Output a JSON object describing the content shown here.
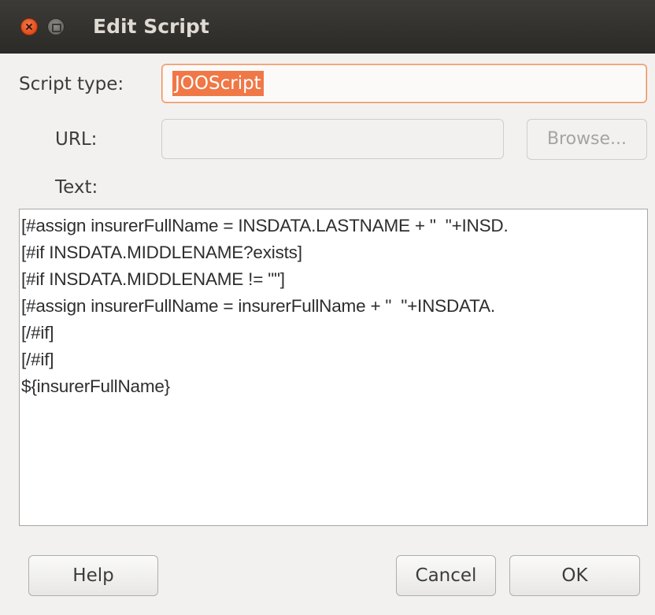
{
  "window": {
    "title": "Edit Script"
  },
  "form": {
    "script_type_label": "Script type:",
    "script_type_value": "JOOScript",
    "url_label": "URL:",
    "url_value": "",
    "browse_label": "Browse...",
    "text_label": "Text:"
  },
  "script_lines": [
    "[#assign insurerFullName = INSDATA.LASTNAME + \"  \"+INSD.",
    "[#if INSDATA.MIDDLENAME?exists]",
    "[#if INSDATA.MIDDLENAME != \"\"]",
    "[#assign insurerFullName = insurerFullName + \"  \"+INSDATA.",
    "[/#if]",
    "[/#if]",
    "${insurerFullName}"
  ],
  "buttons": {
    "help": "Help",
    "cancel": "Cancel",
    "ok": "OK"
  },
  "icons": {
    "close": "close-icon",
    "maximize": "maximize-icon"
  },
  "colors": {
    "accent": "#f07746",
    "titlebar": "#3c3b37",
    "close": "#df4a16"
  }
}
